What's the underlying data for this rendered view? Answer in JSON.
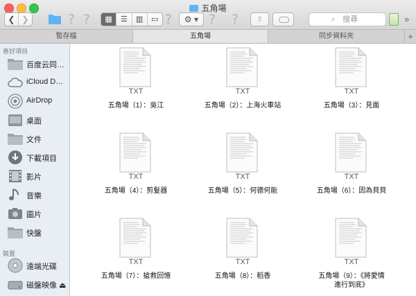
{
  "window": {
    "title": "五角場"
  },
  "toolbar": {
    "search_placeholder": "搜尋"
  },
  "tabs": [
    {
      "label": "暫存檔",
      "active": false
    },
    {
      "label": "五角場",
      "active": true
    },
    {
      "label": "同步資料夾",
      "active": false
    }
  ],
  "sidebar": {
    "favorites_heading": "喜好項目",
    "favorites": [
      {
        "label": "百度云同…",
        "icon": "folder-icon"
      },
      {
        "label": "iCloud D…",
        "icon": "cloud-icon"
      },
      {
        "label": "AirDrop",
        "icon": "airdrop-icon"
      },
      {
        "label": "桌面",
        "icon": "desktop-icon"
      },
      {
        "label": "文件",
        "icon": "documents-folder-icon"
      },
      {
        "label": "下載項目",
        "icon": "downloads-icon"
      },
      {
        "label": "影片",
        "icon": "movies-icon"
      },
      {
        "label": "音樂",
        "icon": "music-icon"
      },
      {
        "label": "圖片",
        "icon": "pictures-icon"
      },
      {
        "label": "快盤",
        "icon": "folder-icon"
      }
    ],
    "devices_heading": "裝置",
    "devices": [
      {
        "label": "遠端光碟",
        "icon": "remote-disc-icon"
      },
      {
        "label": "磁盤映像 ⏏",
        "icon": "disk-image-icon"
      }
    ]
  },
  "files": [
    {
      "name": "五角場（1）：吳江",
      "kind": "TXT"
    },
    {
      "name": "五角場（2）：上海火車站",
      "kind": "TXT"
    },
    {
      "name": "五角場（3）：見面",
      "kind": "TXT"
    },
    {
      "name": "五角場（4）：剪髮器",
      "kind": "TXT"
    },
    {
      "name": "五角場（5）：何德何能",
      "kind": "TXT"
    },
    {
      "name": "五角場（6）：因為貝貝",
      "kind": "TXT"
    },
    {
      "name": "五角場（7）：搶救回憶",
      "kind": "TXT"
    },
    {
      "name": "五角場（8）：稻香",
      "kind": "TXT"
    },
    {
      "name": "五角場（9）：《將愛情進行到底》",
      "kind": "TXT"
    }
  ],
  "colors": {
    "sidebar_bg": "#e9eef4",
    "accent_folder": "#5fb4f2"
  }
}
